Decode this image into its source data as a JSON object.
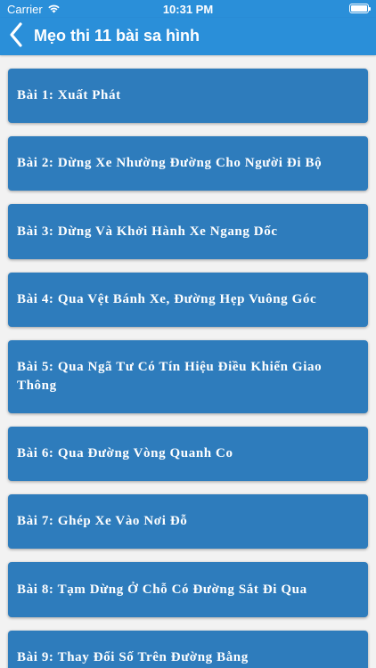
{
  "status_bar": {
    "carrier": "Carrier",
    "time": "10:31 PM"
  },
  "nav": {
    "back_icon": "chevron-left-icon",
    "title": "Mẹo thi 11 bài sa hình"
  },
  "lessons": [
    {
      "label": "Bài 1: Xuất Phát"
    },
    {
      "label": "Bài 2: Dừng Xe Nhường Đường Cho Người Đi Bộ"
    },
    {
      "label": "Bài 3: Dừng Và Khởi Hành Xe Ngang Dốc"
    },
    {
      "label": "Bài 4: Qua Vệt Bánh Xe, Đường Hẹp Vuông Góc"
    },
    {
      "label": "Bài 5: Qua Ngã Tư Có Tín Hiệu Điều Khiển Giao Thông"
    },
    {
      "label": "Bài 6: Qua Đường Vòng Quanh Co"
    },
    {
      "label": "Bài 7: Ghép Xe Vào Nơi Đỗ"
    },
    {
      "label": "Bài 8: Tạm Dừng Ở Chỗ Có Đường Sắt Đi Qua"
    },
    {
      "label": "Bài 9: Thay Đổi Số Trên Đường Bằng"
    }
  ],
  "colors": {
    "navbar": "#2a8fd9",
    "item_background": "#2e7cbc",
    "page_background": "#f2f2f2",
    "text": "#ffffff"
  }
}
